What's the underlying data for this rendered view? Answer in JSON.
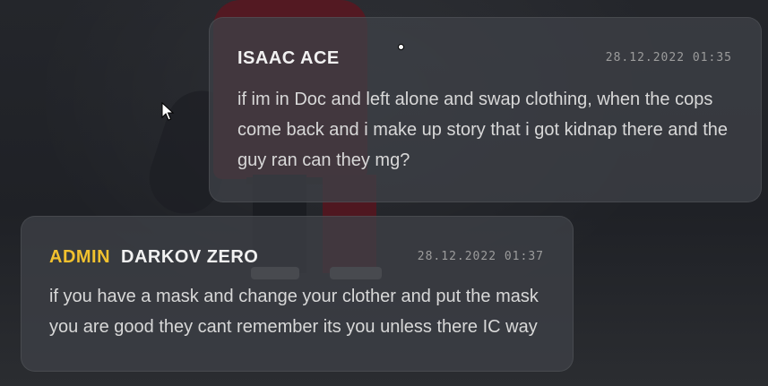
{
  "messages": [
    {
      "author": "ISAAC ACE",
      "timestamp": "28.12.2022 01:35",
      "text": "if im in Doc and left alone and swap clothing, when the cops come back and i make up story that i got kidnap there and the guy ran can they mg?"
    },
    {
      "role_tag": "ADMIN",
      "author": "DARKOV ZERO",
      "timestamp": "28.12.2022 01:37",
      "text": "if you have a mask and change your clother and put the mask you are good they cant remember its you unless there IC way"
    }
  ],
  "colors": {
    "admin_tag": "#f2c12e",
    "card_bg": "#3e4046",
    "text": "#d8d8d8"
  },
  "icons": {
    "cursor": "mouse-pointer-icon"
  }
}
